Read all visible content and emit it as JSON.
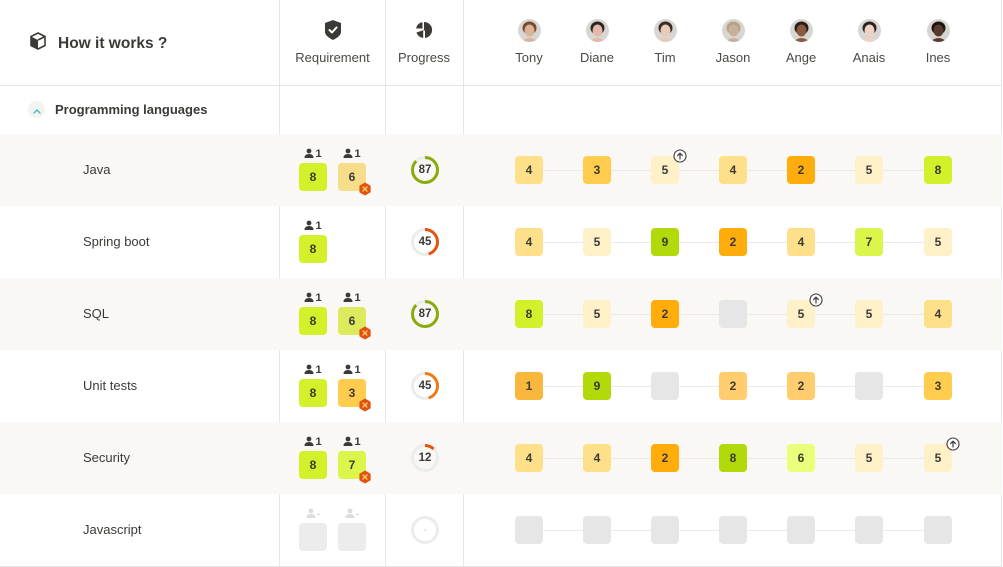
{
  "header": {
    "title": "How it works ?",
    "title_icon": "cube-icon",
    "requirement_label": "Requirement",
    "requirement_icon": "shield-check-icon",
    "progress_label": "Progress",
    "progress_icon": "pie-chart-icon",
    "members": [
      {
        "name": "Tony",
        "skin": "#d9b39a",
        "hair": "#7a4a2a"
      },
      {
        "name": "Diane",
        "skin": "#e5b7a8",
        "hair": "#2b2420"
      },
      {
        "name": "Tim",
        "skin": "#e8cbb5",
        "hair": "#3a2a22"
      },
      {
        "name": "Jason",
        "skin": "#c9b09c",
        "hair": "#b8a283"
      },
      {
        "name": "Ange",
        "skin": "#8a5a3e",
        "hair": "#2a1e18"
      },
      {
        "name": "Anais",
        "skin": "#f0d2c2",
        "hair": "#2a2220"
      },
      {
        "name": "Ines",
        "skin": "#5a3a2c",
        "hair": "#1a1412"
      }
    ]
  },
  "group": {
    "label": "Programming languages",
    "expanded": true
  },
  "colors": {
    "score": {
      "1": "#fab73e",
      "2": "#ffad0d",
      "3": "#ffcc4d",
      "4": "#ffe08a",
      "5": "#fff1c7",
      "6": "#eaff7a",
      "7": "#dcf54a",
      "8": "#d4f02a",
      "9": "#b2d90a",
      "empty": "#e6e6e6"
    },
    "progress_high": "#8bab0c",
    "progress_low": "#e45410",
    "progress_track": "#ececec",
    "badge_red": "#e4500f"
  },
  "rows": [
    {
      "label": "Java",
      "requirements": [
        {
          "count": "1",
          "level": "8",
          "color": "#d4f02a",
          "alert": false
        },
        {
          "count": "1",
          "level": "6",
          "color": "#f5dd8a",
          "alert": true
        }
      ],
      "progress": {
        "value": 87,
        "label": "87",
        "color": "#8bab0c"
      },
      "scores": [
        {
          "value": "4",
          "color": "#ffe08a"
        },
        {
          "value": "3",
          "color": "#ffcc4d"
        },
        {
          "value": "5",
          "color": "#fff1c7",
          "upgrade": true
        },
        {
          "value": "4",
          "color": "#ffe08a"
        },
        {
          "value": "2",
          "color": "#ffad0d"
        },
        {
          "value": "5",
          "color": "#fff1c7"
        },
        {
          "value": "8",
          "color": "#d4f02a"
        }
      ]
    },
    {
      "label": "Spring boot",
      "requirements": [
        {
          "count": "1",
          "level": "8",
          "color": "#d4f02a",
          "alert": false
        }
      ],
      "progress": {
        "value": 45,
        "label": "45",
        "color": "#e45410"
      },
      "scores": [
        {
          "value": "4",
          "color": "#ffe08a"
        },
        {
          "value": "5",
          "color": "#fff1c7"
        },
        {
          "value": "9",
          "color": "#b2d90a"
        },
        {
          "value": "2",
          "color": "#ffad0d"
        },
        {
          "value": "4",
          "color": "#ffe08a"
        },
        {
          "value": "7",
          "color": "#dcf54a"
        },
        {
          "value": "5",
          "color": "#fff1c7"
        }
      ]
    },
    {
      "label": "SQL",
      "requirements": [
        {
          "count": "1",
          "level": "8",
          "color": "#d4f02a",
          "alert": false
        },
        {
          "count": "1",
          "level": "6",
          "color": "#dcea5e",
          "alert": true
        }
      ],
      "progress": {
        "value": 87,
        "label": "87",
        "color": "#8bab0c"
      },
      "scores": [
        {
          "value": "8",
          "color": "#d4f02a"
        },
        {
          "value": "5",
          "color": "#fff1c7"
        },
        {
          "value": "2",
          "color": "#ffad0d"
        },
        {
          "value": "",
          "color": "#e6e6e6"
        },
        {
          "value": "5",
          "color": "#fff1c7",
          "upgrade": true
        },
        {
          "value": "5",
          "color": "#fff1c7"
        },
        {
          "value": "4",
          "color": "#ffe08a"
        }
      ]
    },
    {
      "label": "Unit tests",
      "requirements": [
        {
          "count": "1",
          "level": "8",
          "color": "#d4f02a",
          "alert": false
        },
        {
          "count": "1",
          "level": "3",
          "color": "#ffcc4d",
          "alert": true
        }
      ],
      "progress": {
        "value": 45,
        "label": "45",
        "color": "#f07a1a"
      },
      "scores": [
        {
          "value": "1",
          "color": "#fab73e"
        },
        {
          "value": "9",
          "color": "#b2d90a"
        },
        {
          "value": "",
          "color": "#e6e6e6"
        },
        {
          "value": "2",
          "color": "#ffcc6e"
        },
        {
          "value": "2",
          "color": "#ffcc6e"
        },
        {
          "value": "",
          "color": "#e6e6e6"
        },
        {
          "value": "3",
          "color": "#ffcc4d"
        }
      ]
    },
    {
      "label": "Security",
      "requirements": [
        {
          "count": "1",
          "level": "8",
          "color": "#d4f02a",
          "alert": false
        },
        {
          "count": "1",
          "level": "7",
          "color": "#dcf54a",
          "alert": true
        }
      ],
      "progress": {
        "value": 12,
        "label": "12",
        "color": "#e45410"
      },
      "scores": [
        {
          "value": "4",
          "color": "#ffe08a"
        },
        {
          "value": "4",
          "color": "#ffe08a"
        },
        {
          "value": "2",
          "color": "#ffad0d"
        },
        {
          "value": "8",
          "color": "#b2d90a"
        },
        {
          "value": "6",
          "color": "#eaff7a"
        },
        {
          "value": "5",
          "color": "#fff1c7"
        },
        {
          "value": "5",
          "color": "#fff1c7",
          "upgrade": true
        }
      ]
    },
    {
      "label": "Javascript",
      "requirements": [
        {
          "count": "-",
          "level": "",
          "color": "#ececec",
          "alert": false,
          "disabled": true
        },
        {
          "count": "-",
          "level": "",
          "color": "#ececec",
          "alert": false,
          "disabled": true
        }
      ],
      "progress": {
        "value": 0,
        "label": "-",
        "color": "#ececec"
      },
      "scores": [
        {
          "value": "",
          "color": "#e6e6e6"
        },
        {
          "value": "",
          "color": "#e6e6e6"
        },
        {
          "value": "",
          "color": "#e6e6e6"
        },
        {
          "value": "",
          "color": "#e6e6e6"
        },
        {
          "value": "",
          "color": "#e6e6e6"
        },
        {
          "value": "",
          "color": "#e6e6e6"
        },
        {
          "value": "",
          "color": "#e6e6e6"
        }
      ]
    }
  ]
}
